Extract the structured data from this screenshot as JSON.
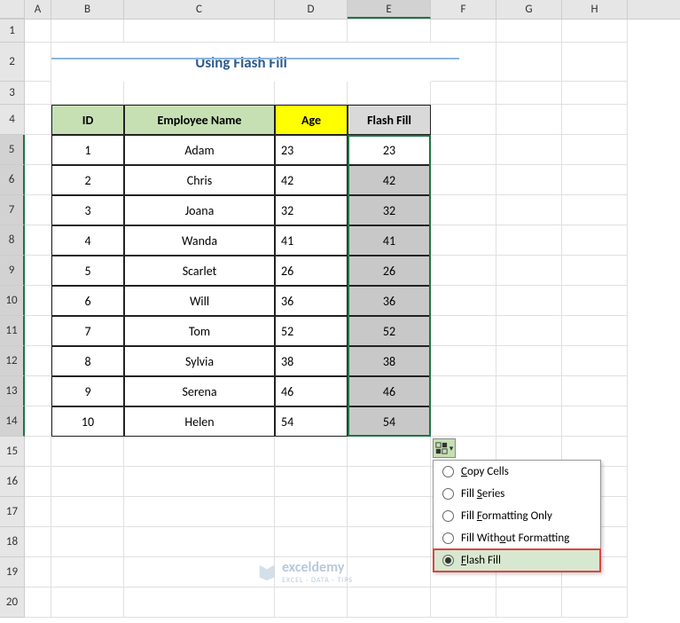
{
  "title": "Using Flash Fill",
  "columns": [
    "A",
    "B",
    "C",
    "D",
    "E",
    "F",
    "G",
    "H"
  ],
  "rowNumbers": [
    "1",
    "2",
    "3",
    "4",
    "5",
    "6",
    "7",
    "8",
    "9",
    "10",
    "11",
    "12",
    "13",
    "14",
    "15",
    "16",
    "17",
    "18",
    "19",
    "20"
  ],
  "headers": {
    "id": "ID",
    "name": "Employee Name",
    "age": "Age",
    "flash": "Flash Fill"
  },
  "data": [
    {
      "id": "1",
      "name": "Adam",
      "age": "23",
      "flash": "23"
    },
    {
      "id": "2",
      "name": "Chris",
      "age": "42",
      "flash": "42"
    },
    {
      "id": "3",
      "name": "Joana",
      "age": "32",
      "flash": "32"
    },
    {
      "id": "4",
      "name": "Wanda",
      "age": "41",
      "flash": "41"
    },
    {
      "id": "5",
      "name": "Scarlet",
      "age": "26",
      "flash": "26"
    },
    {
      "id": "6",
      "name": "Will",
      "age": "36",
      "flash": "36"
    },
    {
      "id": "7",
      "name": "Tom",
      "age": "52",
      "flash": "52"
    },
    {
      "id": "8",
      "name": "Sylvia",
      "age": "38",
      "flash": "38"
    },
    {
      "id": "9",
      "name": "Serena",
      "age": "46",
      "flash": "46"
    },
    {
      "id": "10",
      "name": "Helen",
      "age": "54",
      "flash": "54"
    }
  ],
  "menu": {
    "copy": "Copy Cells",
    "series": "Fill Series",
    "formatting": "Fill Formatting Only",
    "noformat": "Fill Without Formatting",
    "flash": "Flash Fill"
  },
  "watermark": {
    "brand": "exceldemy",
    "sub": "EXCEL · DATA · TIPS"
  },
  "chart_data": {
    "type": "table",
    "title": "Using Flash Fill",
    "columns": [
      "ID",
      "Employee Name",
      "Age",
      "Flash Fill"
    ],
    "rows": [
      [
        1,
        "Adam",
        23,
        23
      ],
      [
        2,
        "Chris",
        42,
        42
      ],
      [
        3,
        "Joana",
        32,
        32
      ],
      [
        4,
        "Wanda",
        41,
        41
      ],
      [
        5,
        "Scarlet",
        26,
        26
      ],
      [
        6,
        "Will",
        36,
        36
      ],
      [
        7,
        "Tom",
        52,
        52
      ],
      [
        8,
        "Sylvia",
        38,
        38
      ],
      [
        9,
        "Serena",
        46,
        46
      ],
      [
        10,
        "Helen",
        54,
        54
      ]
    ]
  }
}
